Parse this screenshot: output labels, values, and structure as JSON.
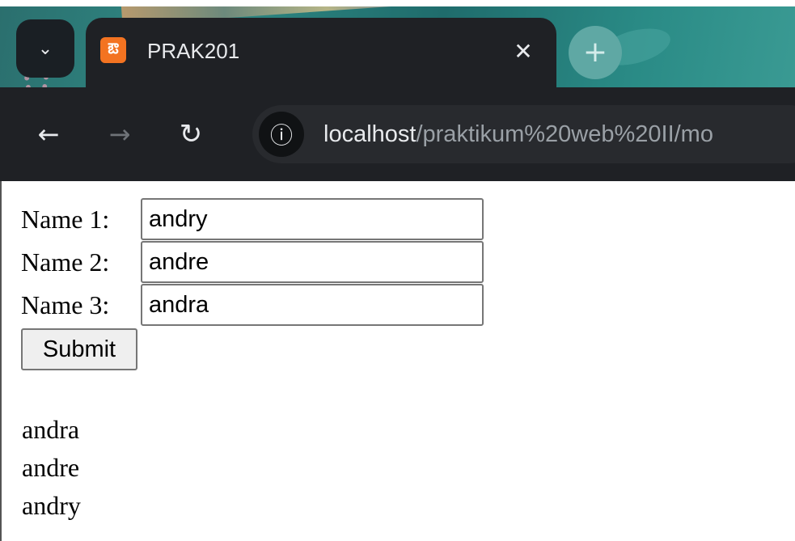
{
  "browser": {
    "tab": {
      "title": "PRAK201",
      "favicon": "xampp-icon",
      "close_icon": "close-icon"
    },
    "new_tab_icon": "plus-icon",
    "tab_search_icon": "chevron-down-icon",
    "toolbar": {
      "back_icon": "arrow-left-icon",
      "forward_icon": "arrow-right-icon",
      "reload_icon": "reload-icon",
      "site_info_icon": "info-icon"
    },
    "url": {
      "host": "localhost",
      "path": "/praktikum%20web%20II/mo"
    }
  },
  "form": {
    "fields": [
      {
        "label": "Name 1:",
        "value": "andry"
      },
      {
        "label": "Name 2:",
        "value": "andre"
      },
      {
        "label": "Name 3:",
        "value": "andra"
      }
    ],
    "submit_label": "Submit"
  },
  "output": {
    "lines": [
      "andra",
      "andre",
      "andry"
    ]
  },
  "colors": {
    "chrome_dark": "#1f2125",
    "favicon_orange": "#f37321",
    "url_path_gray": "#9aa0a6"
  }
}
